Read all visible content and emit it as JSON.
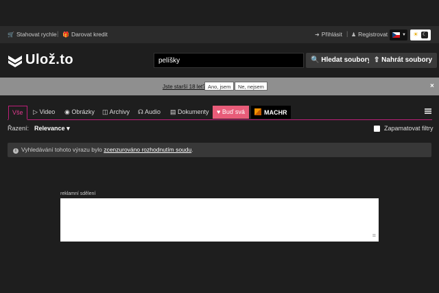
{
  "topbar": {
    "download_fast": "Stahovat rychle",
    "gift_credit": "Darovat kredit",
    "login": "Přihlásit",
    "register": "Registrovat",
    "language": "cz",
    "theme_toggle": "light-dark"
  },
  "header": {
    "logo_text": "Ulož.to",
    "search_value": "pelíšky",
    "search_button": "Hledat soubory",
    "upload_button": "Nahrát soubory"
  },
  "age_bar": {
    "question": "Jste starší 18 let?",
    "yes": "Ano, jsem",
    "no": "Ne, nejsem",
    "close": "×"
  },
  "tabs": [
    {
      "label": "Vše",
      "icon": ""
    },
    {
      "label": "Video",
      "icon": "play-icon"
    },
    {
      "label": "Obrázky",
      "icon": "camera-icon"
    },
    {
      "label": "Archivy",
      "icon": "archive-icon"
    },
    {
      "label": "Audio",
      "icon": "headphones-icon"
    },
    {
      "label": "Dokumenty",
      "icon": "document-icon"
    },
    {
      "label": "Buď svá",
      "icon": "thumb-icon"
    },
    {
      "label": "MACHR",
      "icon": "machr-logo"
    }
  ],
  "sort": {
    "label": "Řazení:",
    "value": "Relevance"
  },
  "remember_filters": "Zapamatovat filtry",
  "notice": {
    "text_before": "Vyhledávání tohoto výrazu bylo ",
    "link": "zcenzurováno rozhodnutím soudu",
    "text_after": "."
  },
  "ad": {
    "label": "reklamní sdělení"
  },
  "colors": {
    "accent": "#c01f7a",
    "pink_tab": "#e85c79",
    "background": "#1e1e1e"
  }
}
